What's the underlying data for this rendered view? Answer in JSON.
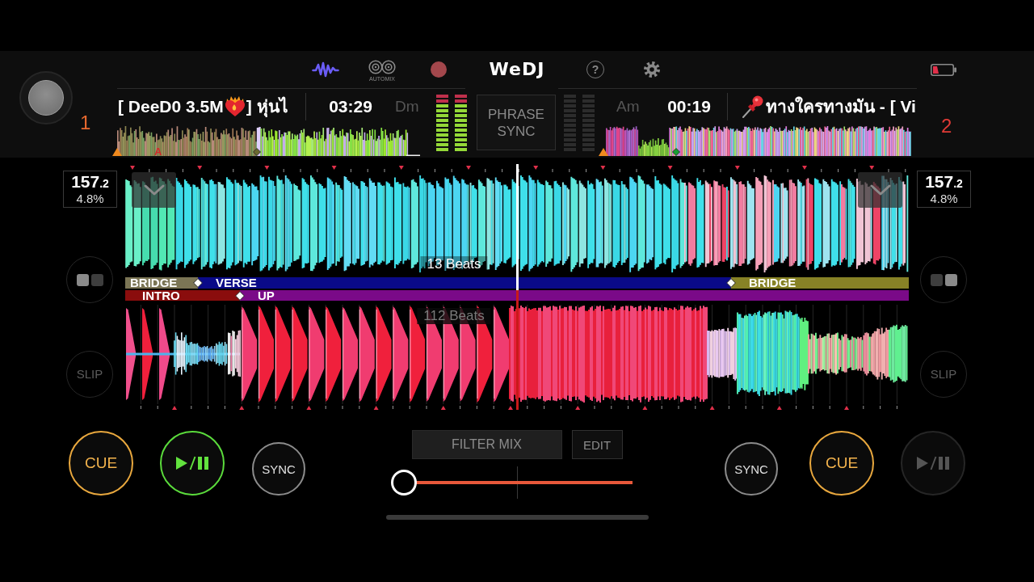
{
  "header": {
    "automix": "AUTOMIX",
    "logo": "WeDJ",
    "help": "?",
    "phrase_sync": "PHRASE SYNC"
  },
  "decks": [
    {
      "number": "1",
      "color": "#e8692f",
      "title": "[ DeeD0 3.5M",
      "title_end": "] หุ่นไ",
      "time": "03:29",
      "key": "Dm",
      "meters": [
        {
          "level": 1
        },
        {
          "level": 1
        }
      ],
      "hot_cue": "A",
      "bpm": "157",
      "bpm_decimal": ".2",
      "pitch": "4.8%",
      "beats": "13 Beats",
      "slip": "SLIP",
      "cue": "CUE",
      "sync": "SYNC",
      "playing": true
    },
    {
      "number": "2",
      "color": "#e03a36",
      "title": "ทางใครทางมัน - [ Vi",
      "time": "00:19",
      "key": "Am",
      "meters": [
        {
          "level": 0
        },
        {
          "level": 0
        }
      ],
      "bpm": "157",
      "bpm_decimal": ".2",
      "pitch": "4.8%",
      "beats": "112 Beats",
      "slip": "SLIP",
      "cue": "CUE",
      "sync": "SYNC",
      "playing": false
    }
  ],
  "phrase_tracks": [
    {
      "segments": [
        {
          "label": "BRIDGE",
          "color": "#7b7555"
        },
        {
          "label": "VERSE",
          "color": "#0a0a88"
        },
        {
          "label": "BRIDGE",
          "color": "#878226"
        }
      ]
    },
    {
      "segments": [
        {
          "label": "INTRO",
          "color": "#8a0d0d"
        },
        {
          "label": "UP",
          "color": "#7a0a88"
        }
      ]
    }
  ],
  "mixer": {
    "filter_mix": "FILTER MIX",
    "edit": "EDIT",
    "filter": {
      "level": 0
    }
  }
}
